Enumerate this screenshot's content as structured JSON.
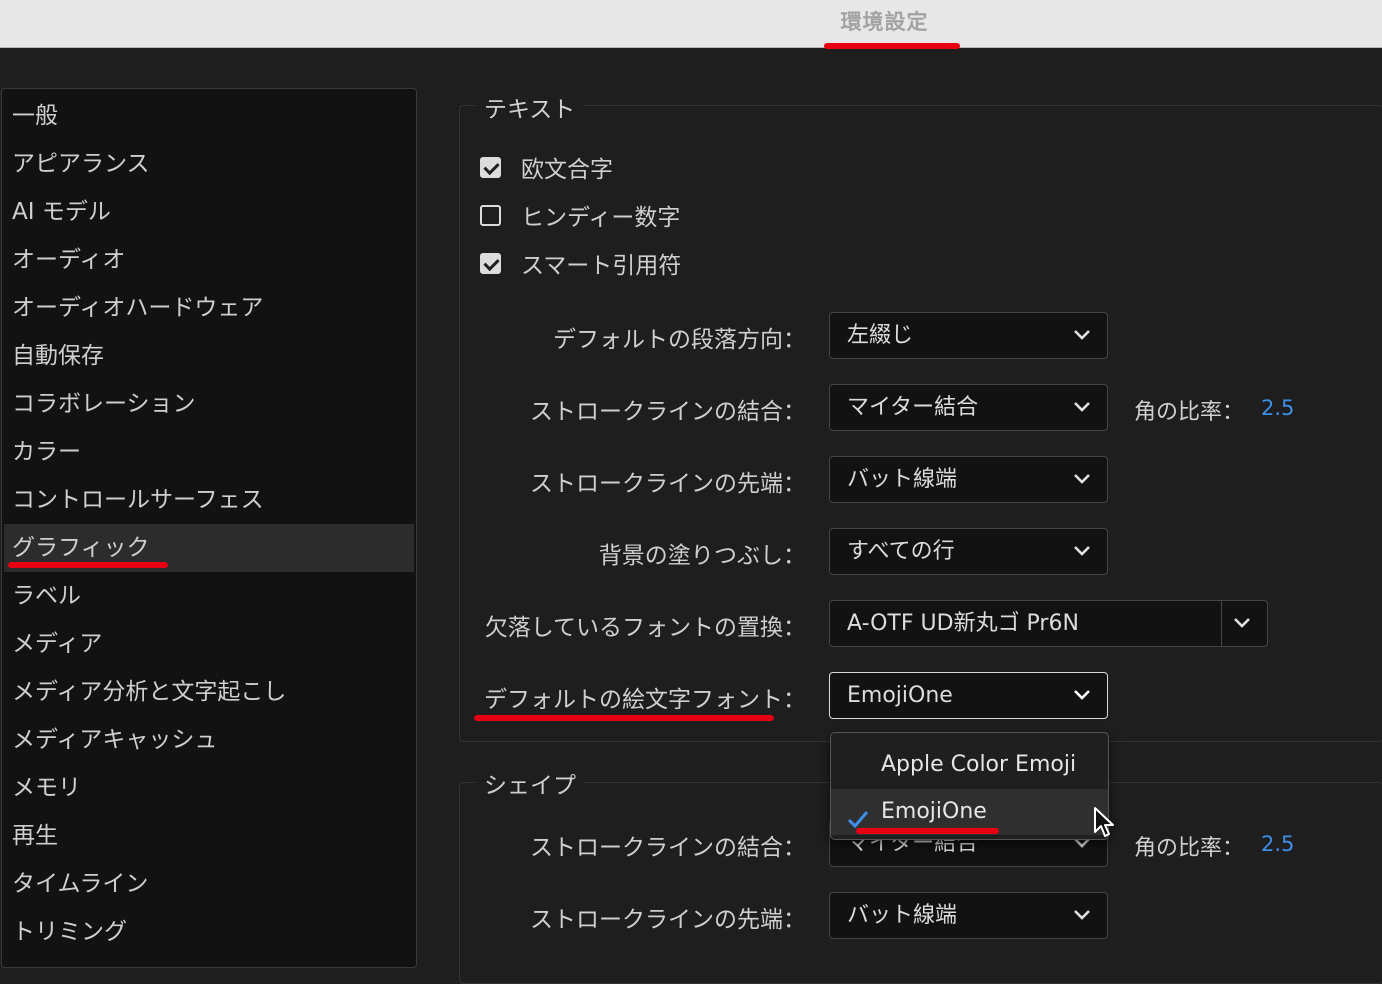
{
  "window": {
    "title": "環境設定"
  },
  "sidebar": {
    "items": [
      "一般",
      "アピアランス",
      "AI モデル",
      "オーディオ",
      "オーディオハードウェア",
      "自動保存",
      "コラボレーション",
      "カラー",
      "コントロールサーフェス",
      "グラフィック",
      "ラベル",
      "メディア",
      "メディア分析と文字起こし",
      "メディアキャッシュ",
      "メモリ",
      "再生",
      "タイムライン",
      "トリミング"
    ],
    "selected_index": 9
  },
  "text_group": {
    "title": "テキスト",
    "checkboxes": [
      {
        "label": "欧文合字",
        "checked": true
      },
      {
        "label": "ヒンディー数字",
        "checked": false
      },
      {
        "label": "スマート引用符",
        "checked": true
      }
    ],
    "paragraph_direction": {
      "label": "デフォルトの段落方向：",
      "value": "左綴じ"
    },
    "stroke_join": {
      "label": "ストロークラインの結合：",
      "value": "マイター結合",
      "ratio_label": "角の比率：",
      "ratio_value": "2.5"
    },
    "stroke_cap": {
      "label": "ストロークラインの先端：",
      "value": "バット線端"
    },
    "background_fill": {
      "label": "背景の塗りつぶし：",
      "value": "すべての行"
    },
    "missing_font": {
      "label": "欠落しているフォントの置換：",
      "value": "A-OTF UD新丸ゴ Pr6N"
    },
    "emoji_font": {
      "label": "デフォルトの絵文字フォント：",
      "value": "EmojiOne"
    }
  },
  "emoji_menu": {
    "options": [
      "Apple Color Emoji",
      "EmojiOne"
    ],
    "selected": "EmojiOne"
  },
  "shape_group": {
    "title": "シェイプ",
    "stroke_join": {
      "label": "ストロークラインの結合：",
      "value": "マイター結合",
      "ratio_label": "角の比率：",
      "ratio_value": "2.5"
    },
    "stroke_cap": {
      "label": "ストロークラインの先端：",
      "value": "バット線端"
    }
  },
  "colors": {
    "highlight_mark": "#e60012",
    "accent_value": "#3f8fe6"
  }
}
